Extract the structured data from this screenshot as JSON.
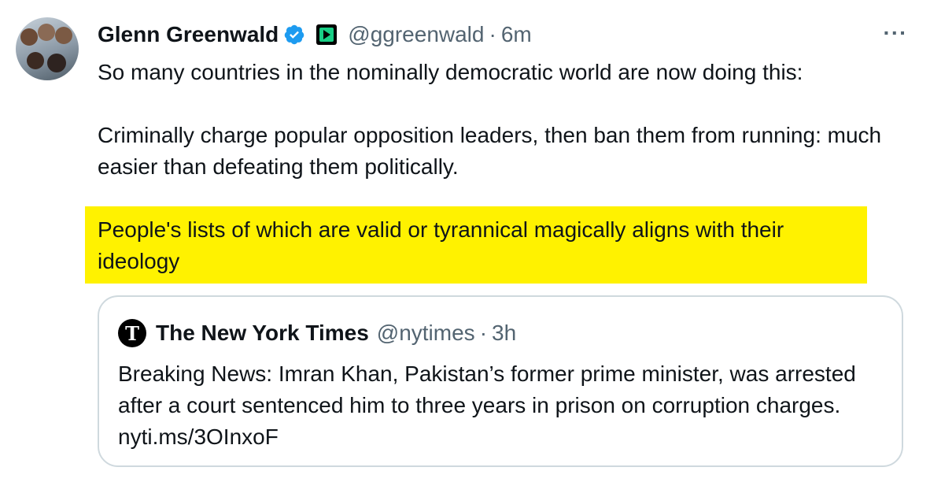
{
  "tweet": {
    "author_name": "Glenn Greenwald",
    "handle": "@ggreenwald",
    "separator": "·",
    "time": "6m",
    "more_label": "···",
    "paragraph_1": "So many countries in the nominally democratic world are now doing this:",
    "paragraph_2": "Criminally charge popular opposition leaders, then ban them from running: much easier than defeating them politically.",
    "highlight_text": "People's lists of which are valid or tyrannical magically aligns with their ideology",
    "verified_color": "#1d9bf0",
    "highlight_color": "#fff200"
  },
  "quoted_tweet": {
    "logo_glyph": "T",
    "author_name": "The New York Times",
    "handle": "@nytimes",
    "separator": "·",
    "time": "3h",
    "text": "Breaking News: Imran Khan, Pakistan’s former prime minister, was arrested after a court sentenced him to three years in prison on corruption charges. nyti.ms/3OInxoF"
  },
  "icons": {
    "verified": "verified-badge-icon",
    "affiliation": "affiliate-badge-icon",
    "more": "more-options-icon",
    "nyt_logo": "nyt-logo-icon"
  }
}
